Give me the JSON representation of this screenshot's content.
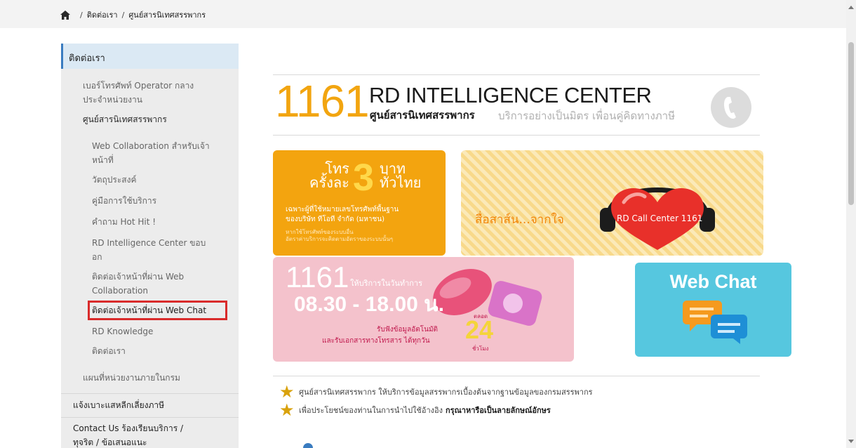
{
  "breadcrumb": {
    "home_icon": "home-icon",
    "separator": "/",
    "items": [
      "ติดต่อเรา",
      "ศูนย์สารนิเทศสรรพากร"
    ]
  },
  "sidebar": {
    "header": "ติดต่อเรา",
    "items": [
      {
        "label_lines": [
          "เบอร์โทรศัพท์ Operator กลาง",
          "ประจำหน่วยงาน"
        ]
      },
      {
        "label_lines": [
          "ศูนย์สารนิเทศสรรพากร"
        ]
      },
      {
        "label_lines": [
          "Web Collaboration สำหรับเจ้า",
          "หน้าที่"
        ]
      },
      {
        "label_lines": [
          "วัตถุประสงค์"
        ]
      },
      {
        "label_lines": [
          "คู่มือการใช้บริการ"
        ]
      },
      {
        "label_lines": [
          "คำถาม Hot Hit !"
        ]
      },
      {
        "label_lines": [
          "RD Intelligence Center ขอบ",
          "อก"
        ]
      },
      {
        "label_lines": [
          "ติดต่อเจ้าหน้าที่ผ่าน Web",
          "Collaboration"
        ]
      },
      {
        "label_lines": [
          "ติดต่อเจ้าหน้าที่ผ่าน Web Chat"
        ],
        "highlighted": true
      },
      {
        "label_lines": [
          "RD Knowledge"
        ]
      },
      {
        "label_lines": [
          "ติดต่อเรา"
        ]
      },
      {
        "label_lines": [
          "แผนที่หน่วยงานภายในกรม"
        ]
      },
      {
        "label_lines": [
          "แจ้งเบาะแสหลีกเลี่ยงภาษี"
        ]
      },
      {
        "label_lines": [
          "Contact Us ร้องเรียนบริการ /",
          "ทุจริต / ข้อเสนอแนะ"
        ]
      }
    ]
  },
  "header": {
    "number": "1161",
    "title": "RD INTELLIGENCE CENTER",
    "subtitle_bold": "ศูนย์สารนิเทศสรรพากร",
    "subtitle_light": "บริการอย่างเป็นมิตร เพื่อนคู่คิดทางภาษี",
    "icon": "phone-icon"
  },
  "tiles": {
    "rate": {
      "word_call": "โทร",
      "word_per_call": "ครั้งละ",
      "price": "3",
      "word_baht": "บาท",
      "word_nationwide": "ทั่วไทย",
      "note_line1": "เฉพาะผู้ที่ใช้หมายเลขโทรศัพท์พื้นฐาน",
      "note_line2": "ของบริษัท ทีโอที จำกัด (มหาชน)",
      "fine_line1": "หากใช้โทรศัพท์ของระบบอื่น",
      "fine_line2": "อัตราค่าบริการจะคิดตามอัตราของระบบนั้นๆ"
    },
    "heart": {
      "text": "สื่อสาส์น...จากใจ",
      "heart_label": "RD Call Center 1161"
    },
    "hours": {
      "number": "1161",
      "service": "ให้บริการในวันทำการ",
      "hours": "08.30 - 18.00 น.",
      "line1": "รับฟังข้อมูลอัตโนมัติ",
      "line2": "และรับเอกสารทางโทรสาร ได้ทุกวัน",
      "round": "ตลอด",
      "big": "24",
      "unit": "ชั่วโมง"
    },
    "chat": {
      "title": "Web Chat",
      "icon": "chat-bubbles-icon"
    }
  },
  "bullets": [
    {
      "text": "ศูนย์สารนิเทศสรรพากร ให้บริการข้อมูลสรรพากรเบื้องต้นจากฐานข้อมูลของกรมสรรพากร",
      "emphasis": ""
    },
    {
      "text": "เพื่อประโยชน์ของท่านในการนำไปใช้อ้างอิง",
      "emphasis": "กรุณาหารือเป็นลายลักษณ์อักษร"
    }
  ],
  "colors": {
    "accent_orange": "#f2a510",
    "highlight_red": "#d92b2b",
    "sidebar_head_bg": "#dbe9f4",
    "chat_blue": "#56c7df",
    "pink": "#f4c2cc"
  }
}
